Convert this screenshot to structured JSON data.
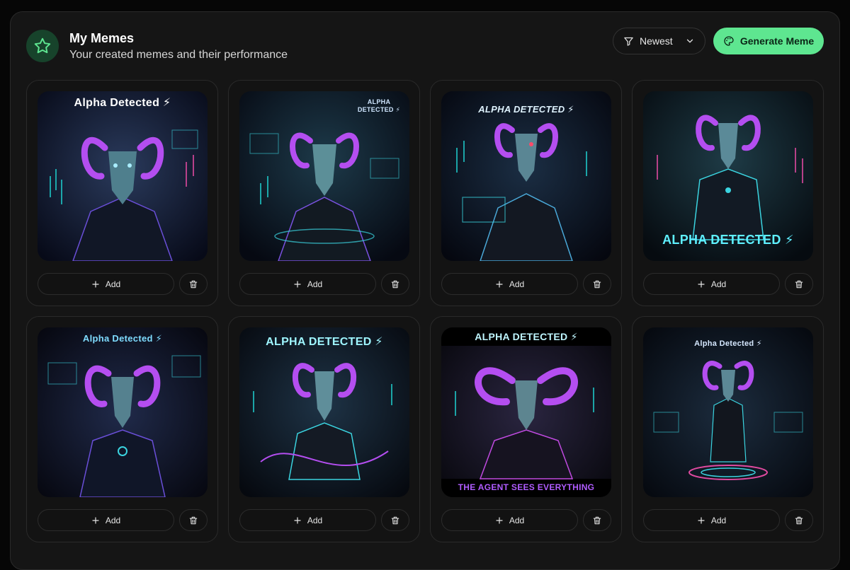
{
  "header": {
    "title": "My Memes",
    "subtitle": "Your created memes and their performance",
    "icon": "star-icon",
    "accent": "#5ee690"
  },
  "toolbar": {
    "sort_label": "Newest",
    "generate_label": "Generate Meme"
  },
  "memes": [
    {
      "caption": "Alpha Detected ⚡",
      "add_label": "Add"
    },
    {
      "caption": "ALPHA DETECTED ⚡",
      "add_label": "Add"
    },
    {
      "caption": "ALPHA DETECTED ⚡",
      "add_label": "Add"
    },
    {
      "caption": "ALPHA DETECTED ⚡",
      "add_label": "Add"
    },
    {
      "caption": "Alpha Detected ⚡",
      "add_label": "Add"
    },
    {
      "caption": "ALPHA DETECTED ⚡",
      "add_label": "Add"
    },
    {
      "caption": "ALPHA DETECTED ⚡",
      "caption2": "THE AGENT SEES EVERYTHING",
      "add_label": "Add"
    },
    {
      "caption": "Alpha Detected ⚡",
      "add_label": "Add"
    }
  ]
}
